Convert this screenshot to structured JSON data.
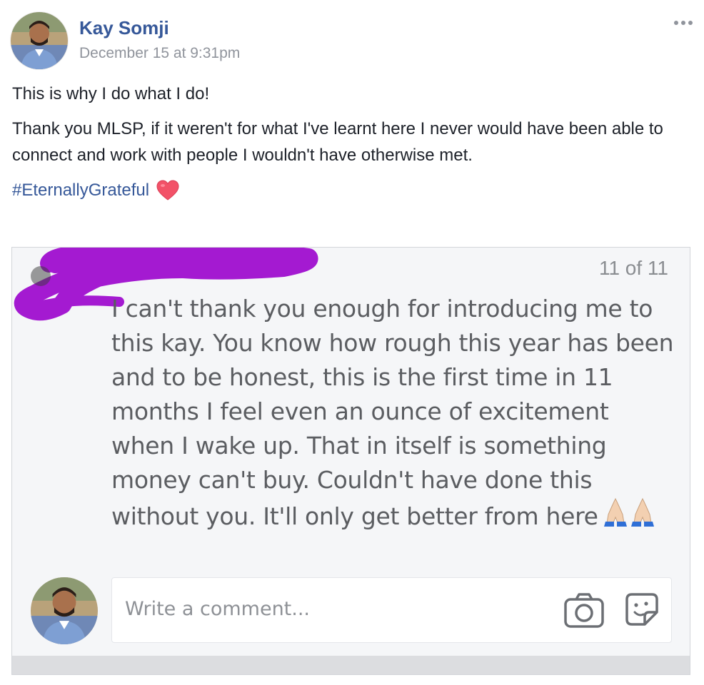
{
  "post": {
    "author": "Kay Somji",
    "timestamp": "December 15 at 9:31pm",
    "more_icon": "more-horizontal-icon",
    "text_line1": "This is why I do what I do!",
    "text_line2": "Thank you MLSP, if it weren't for what I've learnt here I never would have been able to connect and work with people I wouldn't have otherwise met.",
    "hashtag": "#EternallyGrateful",
    "emoji": "heart-icon"
  },
  "shared_image": {
    "counter": "11 of 11",
    "message_text": "I can't thank you enough for introducing me to this kay. You know how rough this year has been and to be honest, this is the first time in 11 months I feel even an ounce of excitement when I wake up. That in itself is something money can't buy. Couldn't have done this without you. It'll only get better from here",
    "emoji": "folded-hands-icon",
    "scribble_color": "#a41ad1",
    "comment_placeholder": "Write a comment...",
    "camera_icon": "camera-icon",
    "sticker_icon": "sticker-icon"
  },
  "colors": {
    "link_blue": "#365899",
    "meta_grey": "#90949c",
    "heart_red": "#f25268"
  }
}
